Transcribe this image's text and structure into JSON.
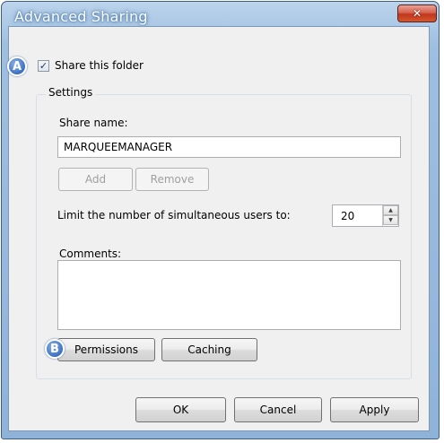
{
  "window": {
    "title": "Advanced Sharing",
    "close_glyph": "✕"
  },
  "markers": {
    "a": "A",
    "b": "B"
  },
  "share": {
    "checked": true,
    "check_glyph": "✓",
    "label": "Share this folder"
  },
  "settings": {
    "group_label": "Settings",
    "share_name_label": "Share name:",
    "share_name_value": "MARQUEEMANAGER",
    "add_label": "Add",
    "remove_label": "Remove",
    "limit_label": "Limit the number of simultaneous users to:",
    "users_value": "20",
    "comments_label": "Comments:",
    "comments_value": "",
    "permissions_label": "Permissions",
    "caching_label": "Caching"
  },
  "footer": {
    "ok_label": "OK",
    "cancel_label": "Cancel",
    "apply_label": "Apply"
  }
}
